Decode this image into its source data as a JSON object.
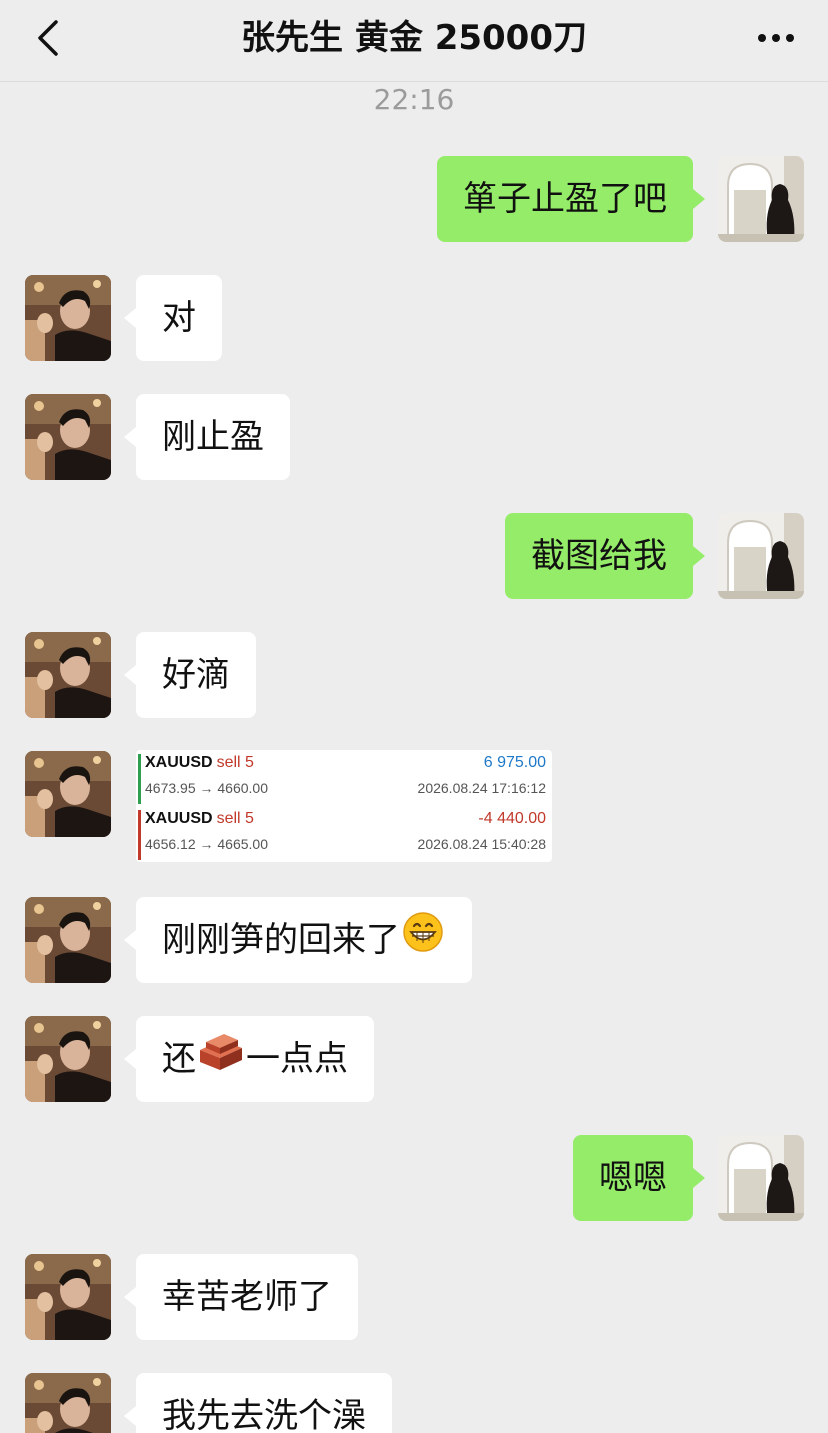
{
  "header": {
    "title": "张先生 黄金 25000刀",
    "back_icon": "chevron-left-icon",
    "more_icon": "more-dots-icon"
  },
  "timestamp": "22:16",
  "colors": {
    "background": "#ededed",
    "sent_bubble": "#95ec69",
    "received_bubble": "#ffffff",
    "profit_blue": "#1e78c8",
    "loss_red": "#c0392b"
  },
  "messages": [
    {
      "side": "right",
      "text": "箪子止盈了吧"
    },
    {
      "side": "left",
      "text": "对"
    },
    {
      "side": "left",
      "text": "刚止盈"
    },
    {
      "side": "right",
      "text": "截图给我"
    },
    {
      "side": "left",
      "text": "好滴"
    },
    {
      "side": "left",
      "type": "image",
      "image": "trade-screenshot"
    },
    {
      "side": "left",
      "text_before": "刚刚笋的回来了",
      "emoji": "grinning-face-icon"
    },
    {
      "side": "left",
      "text_before": "还",
      "emoji": "brick-icon",
      "text_after": "一点点"
    },
    {
      "side": "right",
      "text": "嗯嗯"
    },
    {
      "side": "left",
      "text": "幸苦老师了"
    },
    {
      "side": "left",
      "text": "我先去洗个澡"
    }
  ],
  "trades": [
    {
      "symbol": "XAUUSD",
      "direction": "sell 5",
      "profit": "6 975.00",
      "prices": "4673.95 → 4660.00",
      "time": "2026.08.24 17:16:12",
      "color": "#1e78c8"
    },
    {
      "symbol": "XAUUSD",
      "direction": "sell 5",
      "profit": "-4 440.00",
      "prices": "4656.12 → 4665.00",
      "time": "2026.08.24 15:40:28",
      "color": "#c0392b"
    }
  ]
}
